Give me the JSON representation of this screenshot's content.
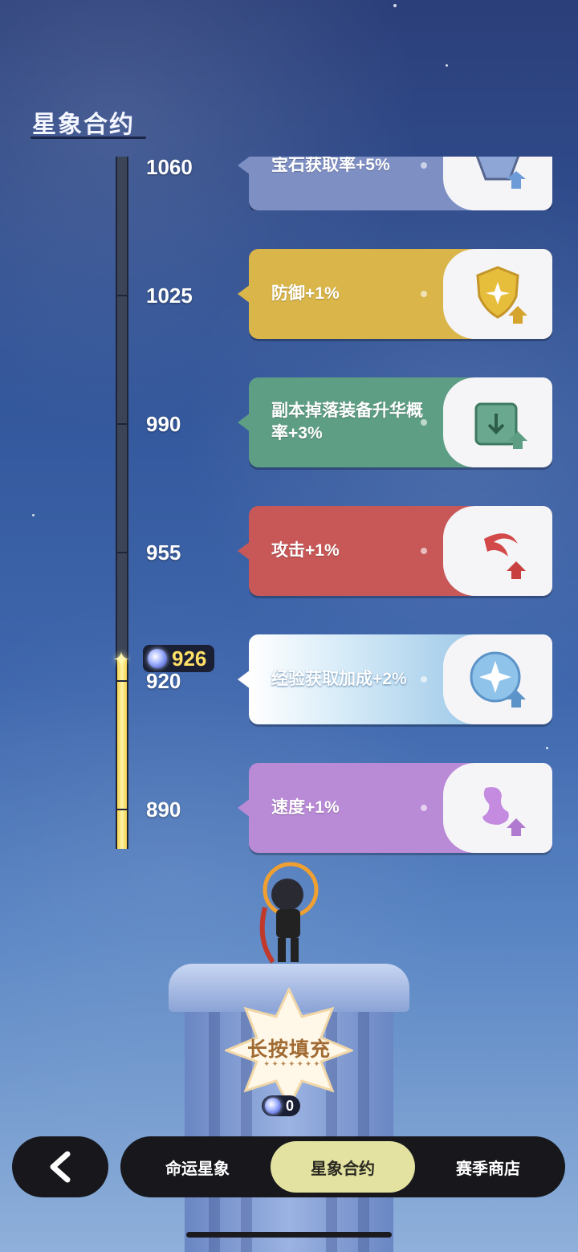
{
  "page_title": "星象合约",
  "current_value": "926",
  "levels": [
    {
      "value": "1060",
      "reward": "宝石获取率+5%",
      "icon": "gem-up-icon",
      "color": "#7e8fc4",
      "reached": false
    },
    {
      "value": "1025",
      "reward": "防御+1%",
      "icon": "shield-up-icon",
      "color": "#d9b54a",
      "reached": false
    },
    {
      "value": "990",
      "reward": "副本掉落装备升华概率+3%",
      "icon": "box-up-icon",
      "color": "#5e9e84",
      "reached": false
    },
    {
      "value": "955",
      "reward": "攻击+1%",
      "icon": "attack-up-icon",
      "color": "#c85858",
      "reached": false
    },
    {
      "value": "920",
      "reward": "经验获取加成+2%",
      "icon": "exp-up-icon",
      "color": "#7fb6e0",
      "reached": true
    },
    {
      "value": "890",
      "reward": "速度+1%",
      "icon": "speed-up-icon",
      "color": "#b98ad6",
      "reached": true
    }
  ],
  "fill_button": {
    "label": "长按填充",
    "count": "0"
  },
  "nav": {
    "back_icon": "back-arrow-icon",
    "tabs": [
      {
        "label": "命运星象",
        "active": false
      },
      {
        "label": "星象合约",
        "active": true
      },
      {
        "label": "赛季商店",
        "active": false
      }
    ]
  }
}
